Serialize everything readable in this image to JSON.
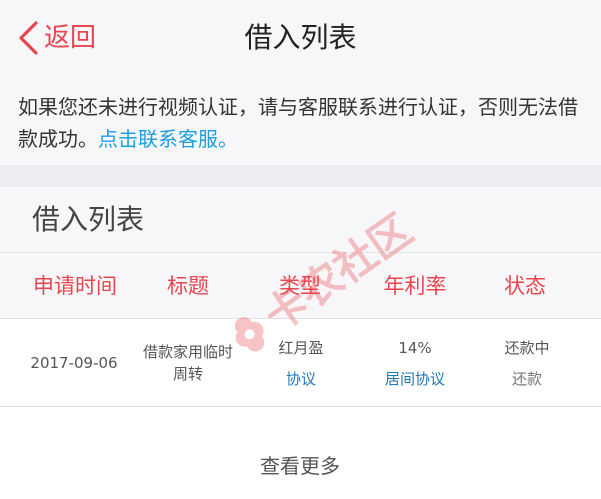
{
  "nav": {
    "back_label": "返回",
    "title": "借入列表"
  },
  "notice": {
    "text": "如果您还未进行视频认证，请与客服联系进行认证，否则无法借款成功。",
    "link": "点击联系客服。"
  },
  "section": {
    "title": "借入列表"
  },
  "table": {
    "headers": [
      "申请时间",
      "标题",
      "类型",
      "年利率",
      "状态"
    ],
    "rows": [
      {
        "date": "2017-09-06",
        "title_line1": "借款家用临时",
        "title_line2": "周转",
        "type": "红月盈",
        "type_link": "协议",
        "rate": "14%",
        "rate_link": "居间协议",
        "status": "还款中",
        "status_action": "还款"
      }
    ]
  },
  "more": {
    "label": "查看更多"
  },
  "watermark": {
    "text": "卡农社区"
  },
  "colors": {
    "accent": "#e8464f",
    "link": "#1a9fe0"
  },
  "icons": {
    "back": "chevron-left-icon"
  }
}
